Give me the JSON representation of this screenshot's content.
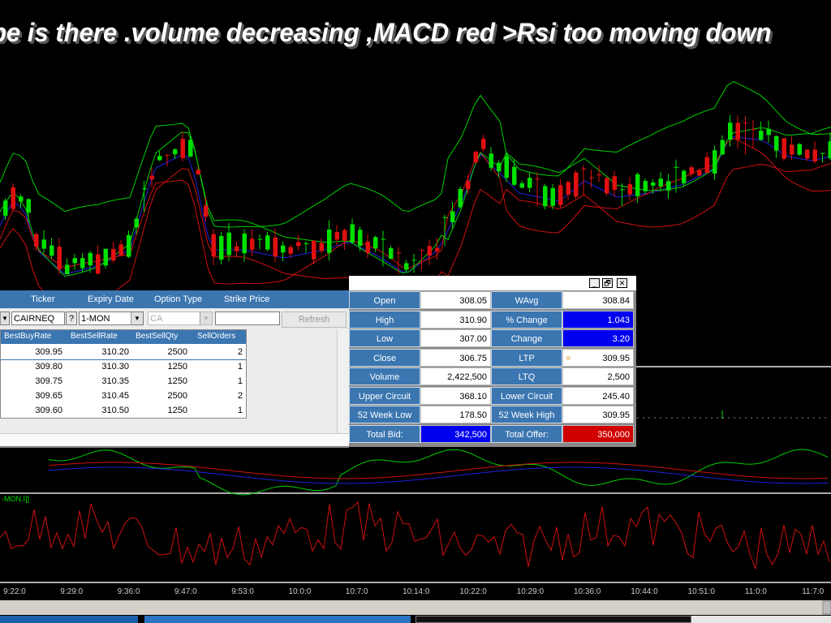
{
  "title": "ope is there .volume decreasing ,MACD red >Rsi too moving down",
  "indicator_label": "-MON.I]]",
  "x_axis_times": [
    "9:22:0",
    "9:29:0",
    "9:36:0",
    "9:47:0",
    "9:53:0",
    "10:0:0",
    "10:7:0",
    "10:14:0",
    "10:22:0",
    "10:29:0",
    "10:36:0",
    "10:44:0",
    "10:51:0",
    "11:0:0",
    "11:7:0"
  ],
  "colors": {
    "up": "#00e000",
    "down": "#e01010",
    "upper_band": "#00d000",
    "lower_band": "#d01010",
    "mid_band": "#2020e0",
    "panel_blue": "#3b76b1",
    "value_blue": "#0000f0",
    "value_red": "#d00000"
  },
  "left_window": {
    "headers": {
      "ticker": "Ticker",
      "expiry": "Expiry Date",
      "option_type": "Option Type",
      "strike_price": "Strike Price"
    },
    "ticker_value": "CAIRNEQ",
    "help_button": "?",
    "expiry_value": "1-MON",
    "option_type_value": "CA",
    "refresh_label": "Refresh",
    "depth_headers": {
      "best_buy_rate": "BestBuyRate",
      "best_sell_rate": "BestSellRate",
      "best_sell_qty": "BestSellQty",
      "sell_orders": "SellOrders"
    },
    "depth_rows": [
      {
        "buy": "309.95",
        "sell": "310.20",
        "qty": "2500",
        "orders": "2"
      },
      {
        "buy": "309.80",
        "sell": "310.30",
        "qty": "1250",
        "orders": "1"
      },
      {
        "buy": "309.75",
        "sell": "310.35",
        "qty": "1250",
        "orders": "1"
      },
      {
        "buy": "309.65",
        "sell": "310.45",
        "qty": "2500",
        "orders": "2"
      },
      {
        "buy": "309.60",
        "sell": "310.50",
        "qty": "1250",
        "orders": "1"
      }
    ]
  },
  "quote_panel": {
    "window_buttons": {
      "minimize": "_",
      "restore": "🗗",
      "close": "✕"
    },
    "rows": [
      {
        "l1": "Open",
        "v1": "308.05",
        "l2": "WAvg",
        "v2": "308.84"
      },
      {
        "l1": "High",
        "v1": "310.90",
        "l2": "% Change",
        "v2": "1.043"
      },
      {
        "l1": "Low",
        "v1": "307.00",
        "l2": "Change",
        "v2": "3.20"
      },
      {
        "l1": "Close",
        "v1": "306.75",
        "l2": "LTP",
        "v2": "309.95"
      },
      {
        "l1": "Volume",
        "v1": "2,422,500",
        "l2": "LTQ",
        "v2": "2,500"
      },
      {
        "l1": "Upper Circuit",
        "v1": "368.10",
        "l2": "Lower Circuit",
        "v2": "245.40"
      },
      {
        "l1": "52 Week Low",
        "v1": "178.50",
        "l2": "52 Week High",
        "v2": "309.95"
      },
      {
        "l1": "Total Bid:",
        "v1": "342,500",
        "l2": "Total Offer:",
        "v2": "350,000"
      }
    ],
    "ltp_marker": "="
  }
}
